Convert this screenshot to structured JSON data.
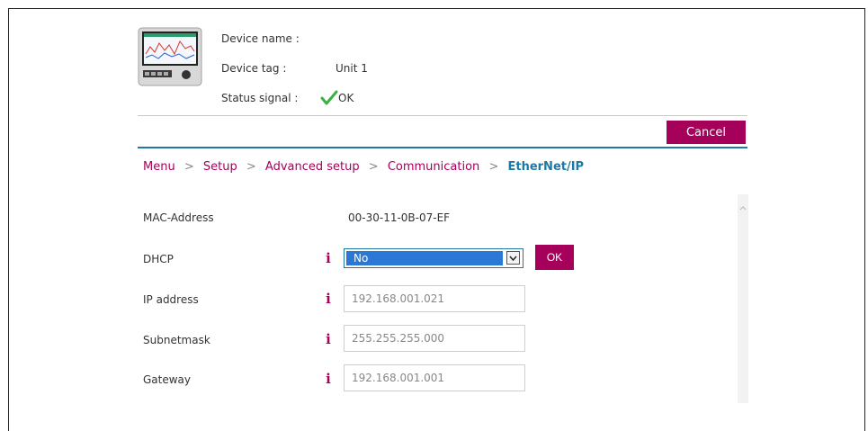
{
  "header": {
    "device_name_label": "Device name :",
    "device_name_value": "",
    "device_tag_label": "Device tag :",
    "device_tag_value": "Unit 1",
    "status_label": "Status signal :",
    "status_value": "OK",
    "status_icon": "check-icon",
    "device_image_icon": "device-icon"
  },
  "toolbar": {
    "cancel_label": "Cancel"
  },
  "breadcrumb": {
    "items": [
      "Menu",
      "Setup",
      "Advanced setup",
      "Communication"
    ],
    "separator": ">",
    "current": "EtherNet/IP"
  },
  "form": {
    "mac": {
      "label": "MAC-Address",
      "value": "00-30-11-0B-07-EF"
    },
    "dhcp": {
      "label": "DHCP",
      "selected": "No",
      "ok_label": "OK"
    },
    "ip": {
      "label": "IP address",
      "value": "192.168.001.021"
    },
    "subnet": {
      "label": "Subnetmask",
      "value": "255.255.255.000"
    },
    "gateway": {
      "label": "Gateway",
      "value": "192.168.001.001"
    },
    "info_glyph": "i"
  },
  "colors": {
    "accent": "#a5005a",
    "link": "#1c7aa5",
    "select_highlight": "#2b78d6",
    "status_ok": "#3cb043"
  }
}
